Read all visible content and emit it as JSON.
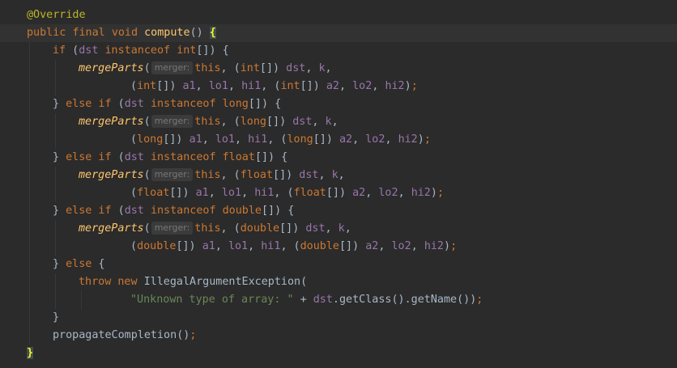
{
  "editor": {
    "annotation": "@Override",
    "signature": {
      "mod1": "public",
      "mod2": "final",
      "ret": "void",
      "name": "compute",
      "parens": "() ",
      "brace": "{"
    },
    "param_hint": "merger:",
    "branches": [
      {
        "lead": "if",
        "type": "int",
        "call": "mergeParts",
        "this_kw": "this",
        "dst": "dst",
        "k": "k",
        "a1": "a1",
        "lo1": "lo1",
        "hi1": "hi1",
        "a2": "a2",
        "lo2": "lo2",
        "hi2": "hi2"
      },
      {
        "lead": "} else if",
        "type": "long",
        "call": "mergeParts",
        "this_kw": "this",
        "dst": "dst",
        "k": "k",
        "a1": "a1",
        "lo1": "lo1",
        "hi1": "hi1",
        "a2": "a2",
        "lo2": "lo2",
        "hi2": "hi2"
      },
      {
        "lead": "} else if",
        "type": "float",
        "call": "mergeParts",
        "this_kw": "this",
        "dst": "dst",
        "k": "k",
        "a1": "a1",
        "lo1": "lo1",
        "hi1": "hi1",
        "a2": "a2",
        "lo2": "lo2",
        "hi2": "hi2"
      },
      {
        "lead": "} else if",
        "type": "double",
        "call": "mergeParts",
        "this_kw": "this",
        "dst": "dst",
        "k": "k",
        "a1": "a1",
        "lo1": "lo1",
        "hi1": "hi1",
        "a2": "a2",
        "lo2": "lo2",
        "hi2": "hi2"
      }
    ],
    "instanceof_kw": "instanceof",
    "else_block": {
      "else_kw": "} else {",
      "throw_kw": "throw",
      "new_kw": "new",
      "exception": "IllegalArgumentException(",
      "message": "\"Unknown type of array: \"",
      "concat": " + ",
      "dst": "dst",
      "chain": ".getClass().getName())",
      "semi": ";"
    },
    "closing_brace": "}",
    "propagate": "propagateCompletion",
    "propagate_tail": "()",
    "propagate_semi": ";",
    "final_brace": "}"
  },
  "colors": {
    "background": "#2b2b2b",
    "current_line": "#323232",
    "keyword": "#cc7832",
    "annotation": "#bbb529",
    "method": "#ffc66d",
    "field": "#9876aa",
    "plain": "#a9b7c6",
    "string": "#6a8759",
    "matched_brace": "#ffef28"
  }
}
